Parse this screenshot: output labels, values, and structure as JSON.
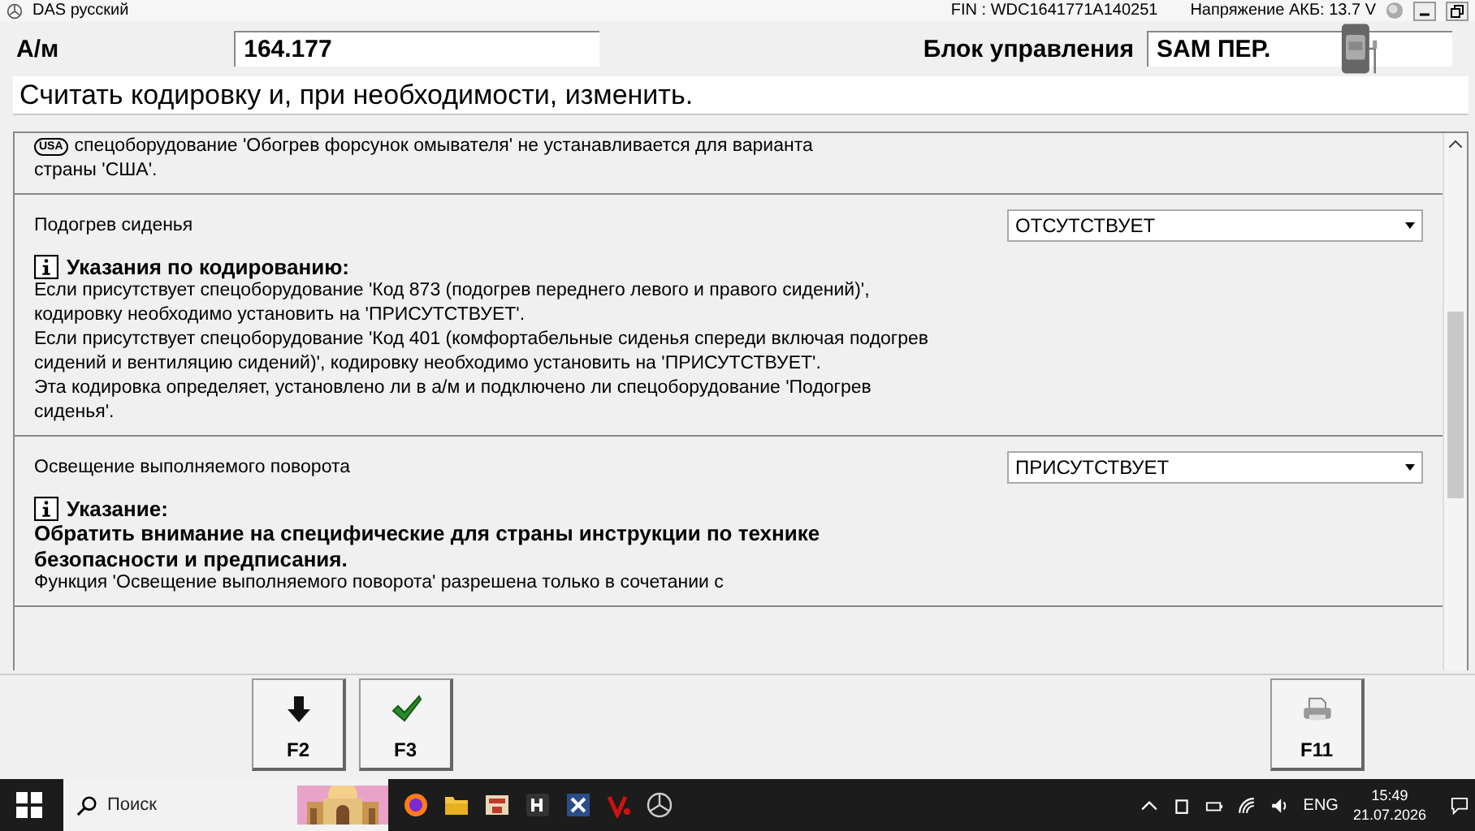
{
  "window": {
    "title": "DAS русский",
    "fin": "FIN : WDC1641771A140251",
    "voltage": "Напряжение АКБ: 13.7 V"
  },
  "header": {
    "vehicle_label": "А/м",
    "vehicle_value": "164.177",
    "unit_label": "Блок управления",
    "unit_value": "SAM ПЕР."
  },
  "instruction": "Считать кодировку и, при необходимости, изменить.",
  "intro": {
    "badge": "USA",
    "lines": [
      "спецоборудование 'Обогрев форсунок омывателя' не устанавливается для варианта",
      "страны 'США'."
    ]
  },
  "sections": [
    {
      "title": "Подогрев сиденья",
      "value": "ОТСУТСТВУЕТ",
      "note_heading": "Указания по кодированию:",
      "paragraphs": [
        {
          "kind": "plain",
          "text": "Если присутствует спецоборудование 'Код 873 (подогрев переднего левого и правого сидений)', кодировку необходимо установить на 'ПРИСУТСТВУЕТ'."
        },
        {
          "kind": "plain",
          "text": "Если присутствует спецоборудование 'Код 401 (комфортабельные сиденья спереди включая подогрев сидений и вентиляцию сидений)', кодировку необходимо установить на 'ПРИСУТСТВУЕТ'."
        },
        {
          "kind": "plain",
          "text": "Эта кодировка определяет, установлено ли в а/м и подключено ли спецоборудование 'Подогрев сиденья'."
        }
      ]
    },
    {
      "title": "Освещение выполняемого поворота",
      "value": "ПРИСУТСТВУЕТ",
      "note_heading": "Указание:",
      "paragraphs": [
        {
          "kind": "bold",
          "text": "Обратить внимание на специфические для страны инструкции по технике безопасности и предписания."
        },
        {
          "kind": "plain",
          "text": "Функция 'Освещение выполняемого поворота' разрешена только в сочетании с"
        }
      ]
    }
  ],
  "buttons": [
    {
      "label": "F2",
      "kind": "down"
    },
    {
      "label": "F3",
      "kind": "confirm"
    },
    {
      "label": "F11",
      "kind": "print"
    }
  ],
  "taskbar": {
    "search_placeholder": "Поиск",
    "language": "ENG",
    "time": "15:49",
    "date": "21.07.2026"
  }
}
